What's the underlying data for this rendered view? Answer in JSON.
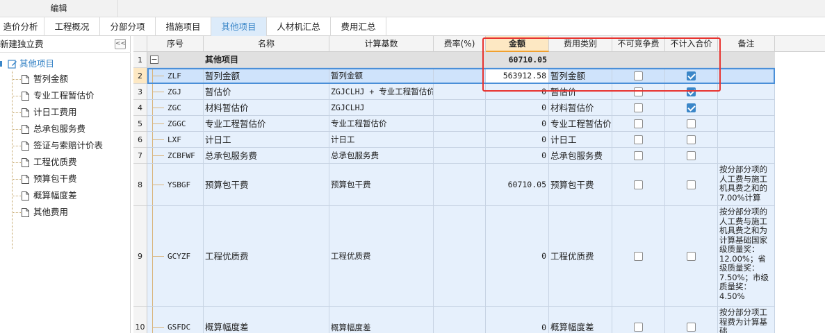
{
  "toolbar": {
    "edit_label": "编辑"
  },
  "tabs": [
    {
      "label": "造价分析"
    },
    {
      "label": "工程概况"
    },
    {
      "label": "分部分项"
    },
    {
      "label": "措施项目"
    },
    {
      "label": "其他项目"
    },
    {
      "label": "人材机汇总"
    },
    {
      "label": "费用汇总"
    }
  ],
  "active_tab": "其他项目",
  "sidebar": {
    "title": "新建独立费",
    "collapse_glyph": "<<",
    "root_label": "其他项目",
    "items": [
      {
        "label": "暂列金额"
      },
      {
        "label": "专业工程暂估价"
      },
      {
        "label": "计日工费用"
      },
      {
        "label": "总承包服务费"
      },
      {
        "label": "签证与索赔计价表"
      },
      {
        "label": "工程优质费"
      },
      {
        "label": "预算包干费"
      },
      {
        "label": "概算幅度差"
      },
      {
        "label": "其他费用"
      }
    ]
  },
  "grid": {
    "columns": {
      "seq": "序号",
      "name": "名称",
      "base": "计算基数",
      "rate": "费率(%)",
      "amount": "金额",
      "category": "费用类别",
      "non_competitive": "不可竞争费",
      "not_in_total": "不计入合价",
      "remark": "备注"
    },
    "group": {
      "num": "1",
      "expander": "−",
      "name": "其他项目",
      "amount": "60710.05"
    },
    "rows": [
      {
        "num": "2",
        "code": "ZLF",
        "name": "暂列金额",
        "base": "暂列金额",
        "rate": "",
        "amount": "563912.58",
        "category": "暂列金额",
        "non_competitive": false,
        "not_in_total": true,
        "remark": ""
      },
      {
        "num": "3",
        "code": "ZGJ",
        "name": "暂估价",
        "base": "ZGJCLHJ + 专业工程暂估价",
        "rate": "",
        "amount": "0",
        "category": "暂估价",
        "non_competitive": false,
        "not_in_total": true,
        "remark": ""
      },
      {
        "num": "4",
        "code": "ZGC",
        "name": "材料暂估价",
        "base": "ZGJCLHJ",
        "rate": "",
        "amount": "0",
        "category": "材料暂估价",
        "non_competitive": false,
        "not_in_total": true,
        "remark": ""
      },
      {
        "num": "5",
        "code": "ZGGC",
        "name": "专业工程暂估价",
        "base": "专业工程暂估价",
        "rate": "",
        "amount": "0",
        "category": "专业工程暂估价",
        "non_competitive": false,
        "not_in_total": false,
        "remark": ""
      },
      {
        "num": "6",
        "code": "LXF",
        "name": "计日工",
        "base": "计日工",
        "rate": "",
        "amount": "0",
        "category": "计日工",
        "non_competitive": false,
        "not_in_total": false,
        "remark": ""
      },
      {
        "num": "7",
        "code": "ZCBFWF",
        "name": "总承包服务费",
        "base": "总承包服务费",
        "rate": "",
        "amount": "0",
        "category": "总承包服务费",
        "non_competitive": false,
        "not_in_total": false,
        "remark": ""
      },
      {
        "num": "8",
        "code": "YSBGF",
        "name": "预算包干费",
        "base": "预算包干费",
        "rate": "",
        "amount": "60710.05",
        "category": "预算包干费",
        "non_competitive": false,
        "not_in_total": false,
        "remark": "按分部分项的人工费与施工机具费之和的7.00%计算"
      },
      {
        "num": "9",
        "code": "GCYZF",
        "name": "工程优质费",
        "base": "工程优质费",
        "rate": "",
        "amount": "0",
        "category": "工程优质费",
        "non_competitive": false,
        "not_in_total": false,
        "remark": "按分部分项的人工费与施工机具费之和为计算基础国家级质量奖：12.00%；省级质量奖：7.50%；市级质量奖：4.50%"
      },
      {
        "num": "10",
        "code": "GSFDC",
        "name": "概算幅度差",
        "base": "概算幅度差",
        "rate": "",
        "amount": "0",
        "category": "概算幅度差",
        "non_competitive": false,
        "not_in_total": false,
        "remark": "按分部分项工程费为计算基础"
      }
    ]
  }
}
